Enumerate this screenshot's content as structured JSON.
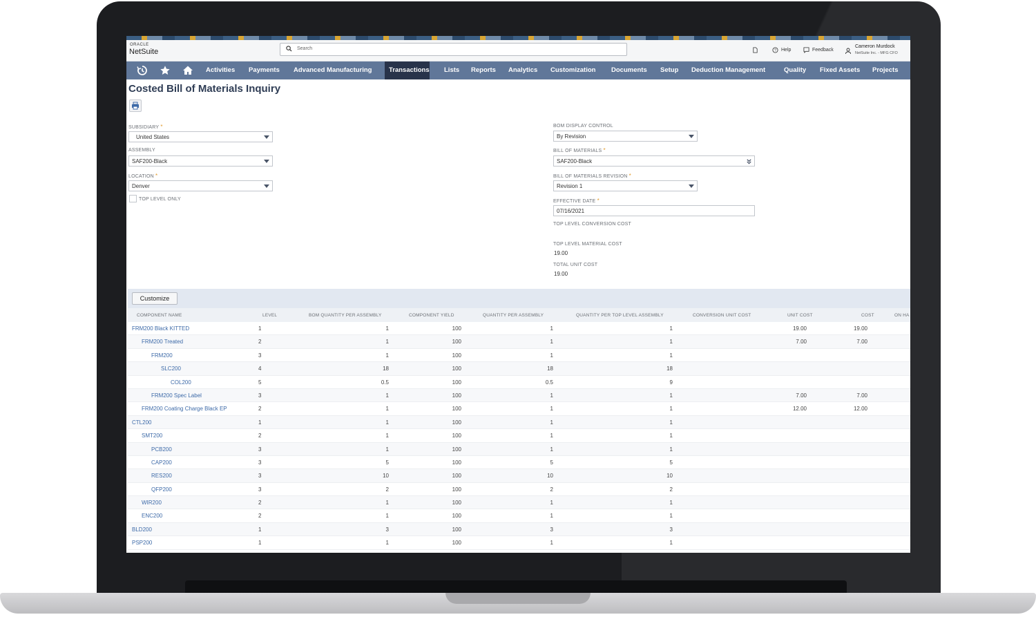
{
  "brand": {
    "oracle": "ORACLE",
    "name": "NetSuite"
  },
  "search": {
    "placeholder": "Search"
  },
  "topbar": {
    "help": "Help",
    "feedback": "Feedback",
    "user_name": "Cameron Murdock",
    "user_role": "NetSuite Inc. - MFG CFO"
  },
  "nav": {
    "items": [
      "Activities",
      "Payments",
      "Advanced Manufacturing",
      "Transactions",
      "Lists",
      "Reports",
      "Analytics",
      "Customization",
      "Documents",
      "Setup",
      "Deduction Management",
      "Quality",
      "Fixed Assets",
      "Projects"
    ],
    "active": "Transactions"
  },
  "page": {
    "title": "Costed Bill of Materials Inquiry"
  },
  "form": {
    "subsidiary": {
      "label": "SUBSIDIARY",
      "value": "United States"
    },
    "assembly": {
      "label": "ASSEMBLY",
      "value": "SAF200-Black"
    },
    "location": {
      "label": "LOCATION",
      "value": "Denver"
    },
    "top_level_only": {
      "label": "TOP LEVEL ONLY"
    },
    "bom_display_control": {
      "label": "BOM DISPLAY CONTROL",
      "value": "By Revision"
    },
    "bill_of_materials": {
      "label": "BILL OF MATERIALS",
      "value": "SAF200-Black"
    },
    "bom_revision": {
      "label": "BILL OF MATERIALS REVISION",
      "value": "Revision 1"
    },
    "effective_date": {
      "label": "EFFECTIVE DATE",
      "value": "07/16/2021"
    },
    "top_level_conversion_cost": {
      "label": "TOP LEVEL CONVERSION COST"
    },
    "top_level_material_cost": {
      "label": "TOP LEVEL MATERIAL COST",
      "value": "19.00"
    },
    "total_unit_cost": {
      "label": "TOTAL UNIT COST",
      "value": "19.00"
    }
  },
  "table": {
    "customize_label": "Customize",
    "columns": [
      "COMPONENT NAME",
      "LEVEL",
      "BOM QUANTITY PER ASSEMBLY",
      "COMPONENT YIELD",
      "QUANTITY PER ASSEMBLY",
      "QUANTITY PER TOP LEVEL ASSEMBLY",
      "CONVERSION UNIT COST",
      "UNIT COST",
      "COST",
      "ON HA"
    ],
    "rows": [
      {
        "name": "FRM200 Black KITTED",
        "level": "1",
        "bom_qty": "1",
        "yield": "100",
        "qty": "1",
        "qty_top": "1",
        "conv": "",
        "unit_cost": "19.00",
        "cost": "19.00"
      },
      {
        "name": "FRM200 Treated",
        "level": "2",
        "bom_qty": "1",
        "yield": "100",
        "qty": "1",
        "qty_top": "1",
        "conv": "",
        "unit_cost": "7.00",
        "cost": "7.00"
      },
      {
        "name": "FRM200",
        "level": "3",
        "bom_qty": "1",
        "yield": "100",
        "qty": "1",
        "qty_top": "1",
        "conv": "",
        "unit_cost": "",
        "cost": ""
      },
      {
        "name": "SLC200",
        "level": "4",
        "bom_qty": "18",
        "yield": "100",
        "qty": "18",
        "qty_top": "18",
        "conv": "",
        "unit_cost": "",
        "cost": ""
      },
      {
        "name": "COL200",
        "level": "5",
        "bom_qty": "0.5",
        "yield": "100",
        "qty": "0.5",
        "qty_top": "9",
        "conv": "",
        "unit_cost": "",
        "cost": ""
      },
      {
        "name": "FRM200 Spec Label",
        "level": "3",
        "bom_qty": "1",
        "yield": "100",
        "qty": "1",
        "qty_top": "1",
        "conv": "",
        "unit_cost": "7.00",
        "cost": "7.00"
      },
      {
        "name": "FRM200 Coating Charge Black EP",
        "level": "2",
        "bom_qty": "1",
        "yield": "100",
        "qty": "1",
        "qty_top": "1",
        "conv": "",
        "unit_cost": "12.00",
        "cost": "12.00"
      },
      {
        "name": "CTL200",
        "level": "1",
        "bom_qty": "1",
        "yield": "100",
        "qty": "1",
        "qty_top": "1",
        "conv": "",
        "unit_cost": "",
        "cost": ""
      },
      {
        "name": "SMT200",
        "level": "2",
        "bom_qty": "1",
        "yield": "100",
        "qty": "1",
        "qty_top": "1",
        "conv": "",
        "unit_cost": "",
        "cost": ""
      },
      {
        "name": "PCB200",
        "level": "3",
        "bom_qty": "1",
        "yield": "100",
        "qty": "1",
        "qty_top": "1",
        "conv": "",
        "unit_cost": "",
        "cost": ""
      },
      {
        "name": "CAP200",
        "level": "3",
        "bom_qty": "5",
        "yield": "100",
        "qty": "5",
        "qty_top": "5",
        "conv": "",
        "unit_cost": "",
        "cost": ""
      },
      {
        "name": "RES200",
        "level": "3",
        "bom_qty": "10",
        "yield": "100",
        "qty": "10",
        "qty_top": "10",
        "conv": "",
        "unit_cost": "",
        "cost": ""
      },
      {
        "name": "QFP200",
        "level": "3",
        "bom_qty": "2",
        "yield": "100",
        "qty": "2",
        "qty_top": "2",
        "conv": "",
        "unit_cost": "",
        "cost": ""
      },
      {
        "name": "WIR200",
        "level": "2",
        "bom_qty": "1",
        "yield": "100",
        "qty": "1",
        "qty_top": "1",
        "conv": "",
        "unit_cost": "",
        "cost": ""
      },
      {
        "name": "ENC200",
        "level": "2",
        "bom_qty": "1",
        "yield": "100",
        "qty": "1",
        "qty_top": "1",
        "conv": "",
        "unit_cost": "",
        "cost": ""
      },
      {
        "name": "BLD200",
        "level": "1",
        "bom_qty": "3",
        "yield": "100",
        "qty": "3",
        "qty_top": "3",
        "conv": "",
        "unit_cost": "",
        "cost": ""
      },
      {
        "name": "PSP200",
        "level": "1",
        "bom_qty": "1",
        "yield": "100",
        "qty": "1",
        "qty_top": "1",
        "conv": "",
        "unit_cost": "",
        "cost": ""
      }
    ]
  },
  "colors": {
    "nav_bg": "#607799",
    "nav_active": "#28334a",
    "link": "#3d6aa8",
    "title": "#2f3d55",
    "required": "#e29a2a"
  }
}
